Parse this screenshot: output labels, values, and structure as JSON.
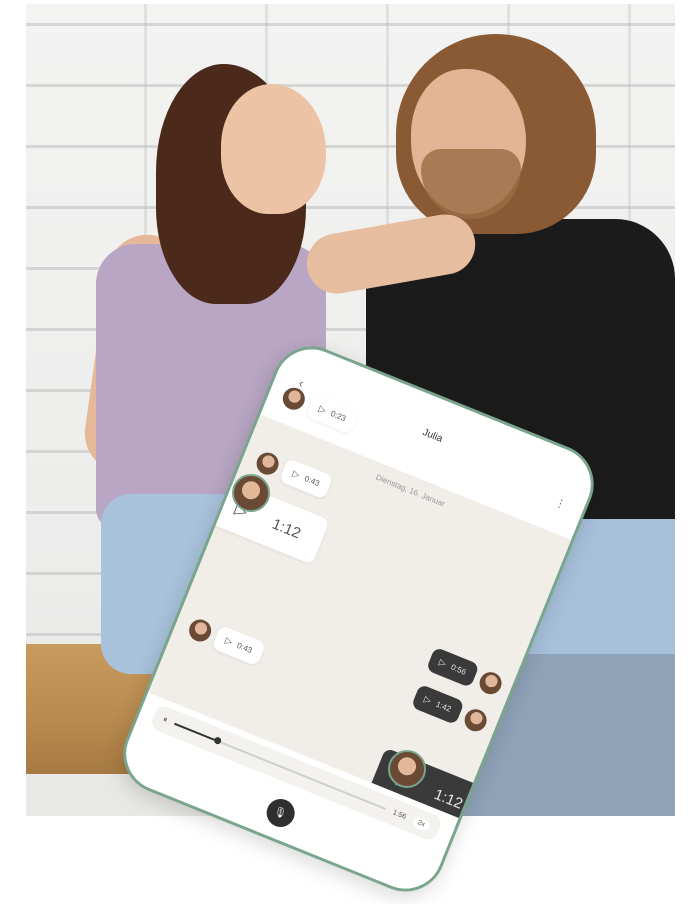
{
  "photo": {
    "description_icon": "couple-photo",
    "colors": {
      "wall": "#f0f0ef",
      "bench": "#c89a5d",
      "accent_border": "#7aa58d"
    }
  },
  "phone": {
    "header": {
      "back_icon": "‹",
      "contact_name": "Julia",
      "menu_icon": "⋮"
    },
    "date_label": "Dienstag, 16. Januar",
    "messages": [
      {
        "side": "in",
        "duration": "0:23"
      },
      {
        "side": "in",
        "duration": "0:43"
      },
      {
        "side": "in",
        "duration": "1:12",
        "big": true
      },
      {
        "side": "out",
        "duration": "0:56"
      },
      {
        "side": "out",
        "duration": "1:42"
      },
      {
        "side": "in",
        "duration": "0:43"
      },
      {
        "side": "out",
        "duration": "1:12",
        "big": true
      }
    ],
    "player": {
      "time": "1:56",
      "speed": "2x",
      "progress": 0.2
    },
    "icons": {
      "play": "▷",
      "pause": "⏸",
      "mic": "🎙"
    }
  }
}
